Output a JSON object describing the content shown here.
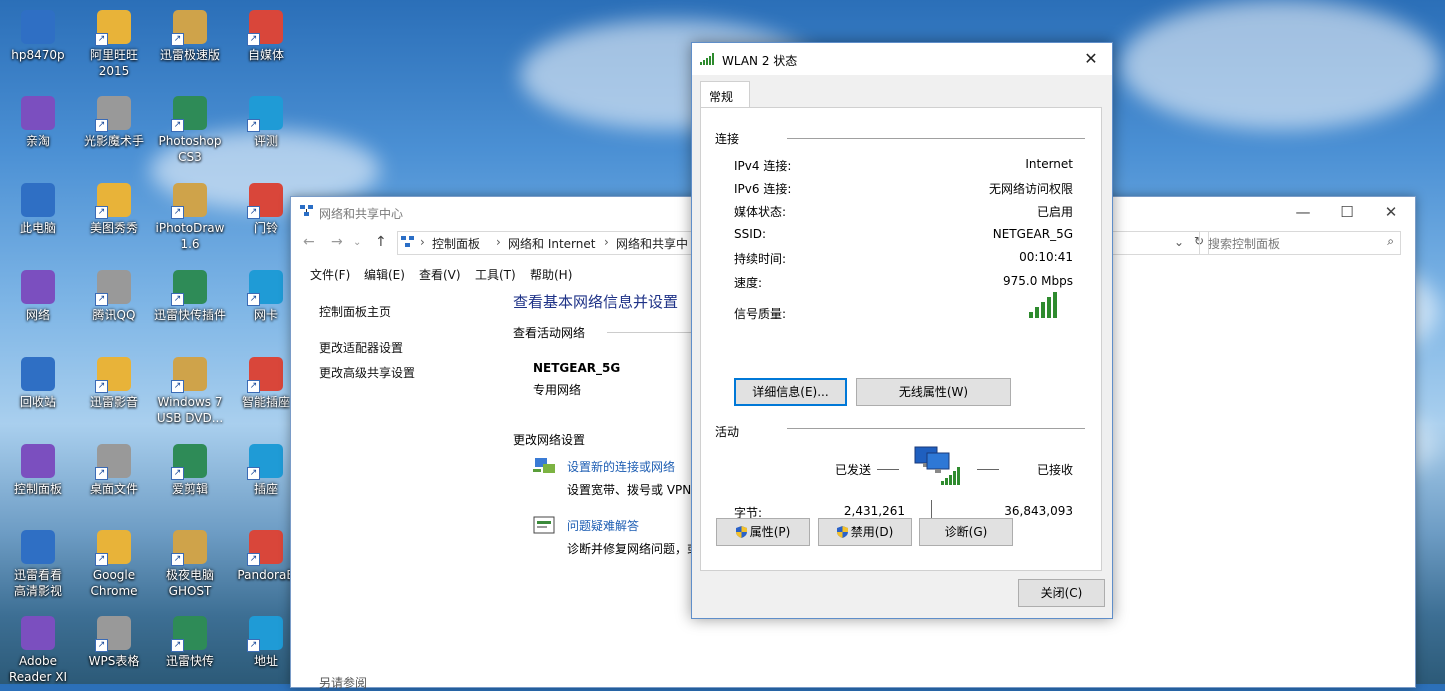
{
  "desktop": {
    "icons": [
      {
        "label": "hp8470p"
      },
      {
        "label": "阿里旺旺\n2015"
      },
      {
        "label": "迅雷极速版"
      },
      {
        "label": "自媒体"
      },
      {
        "label": "亲淘"
      },
      {
        "label": "光影魔术手"
      },
      {
        "label": "Photoshop\nCS3"
      },
      {
        "label": "评测"
      },
      {
        "label": "此电脑"
      },
      {
        "label": "美图秀秀"
      },
      {
        "label": "iPhotoDraw\n1.6"
      },
      {
        "label": "门铃"
      },
      {
        "label": "网络"
      },
      {
        "label": "腾讯QQ"
      },
      {
        "label": "迅雷快传插件"
      },
      {
        "label": "网卡"
      },
      {
        "label": "回收站"
      },
      {
        "label": "迅雷影音"
      },
      {
        "label": "Windows 7\nUSB DVD..."
      },
      {
        "label": "智能插座"
      },
      {
        "label": "控制面板"
      },
      {
        "label": "桌面文件"
      },
      {
        "label": "爱剪辑"
      },
      {
        "label": "插座"
      },
      {
        "label": "迅雷看看\n高清影视"
      },
      {
        "label": "Google\nChrome"
      },
      {
        "label": "极夜电脑\nGHOST"
      },
      {
        "label": "PandoraB"
      },
      {
        "label": "Adobe\nReader XI"
      },
      {
        "label": "WPS表格"
      },
      {
        "label": "迅雷快传"
      },
      {
        "label": "地址"
      }
    ]
  },
  "nsc_window": {
    "title": "网络和共享中心",
    "breadcrumbs": [
      "控制面板",
      "网络和 Internet",
      "网络和共享中"
    ],
    "search_placeholder": "搜索控制面板",
    "menu": [
      "文件(F)",
      "编辑(E)",
      "查看(V)",
      "工具(T)",
      "帮助(H)"
    ],
    "sidebar": [
      "控制面板主页",
      "更改适配器设置",
      "更改高级共享设置"
    ],
    "main": {
      "heading": "查看基本网络信息并设置",
      "active_networks_label": "查看活动网络",
      "network_name": "NETGEAR_5G",
      "network_type": "专用网络",
      "change_settings_label": "更改网络设置",
      "setup_link": "设置新的连接或网络",
      "setup_desc": "设置宽带、拨号或 VPN",
      "troubleshoot_link": "问题疑难解答",
      "troubleshoot_desc": "诊断并修复网络问题，或",
      "see_also": "另请参阅"
    }
  },
  "wlan_dialog": {
    "title": "WLAN 2 状态",
    "tab": "常规",
    "connection_section": "连接",
    "rows": [
      {
        "label": "IPv4 连接:",
        "value": "Internet"
      },
      {
        "label": "IPv6 连接:",
        "value": "无网络访问权限"
      },
      {
        "label": "媒体状态:",
        "value": "已启用"
      },
      {
        "label": "SSID:",
        "value": "NETGEAR_5G"
      },
      {
        "label": "持续时间:",
        "value": "00:10:41"
      },
      {
        "label": "速度:",
        "value": "975.0 Mbps"
      }
    ],
    "signal_label": "信号质量:",
    "signal_bars": 5,
    "details_button": "详细信息(E)...",
    "wireless_props_button": "无线属性(W)",
    "activity_section": "活动",
    "sent_label": "已发送",
    "received_label": "已接收",
    "bytes_label": "字节:",
    "bytes_sent": "2,431,261",
    "bytes_received": "36,843,093",
    "properties_button": "属性(P)",
    "disable_button": "禁用(D)",
    "diagnose_button": "诊断(G)",
    "close_button": "关闭(C)"
  }
}
